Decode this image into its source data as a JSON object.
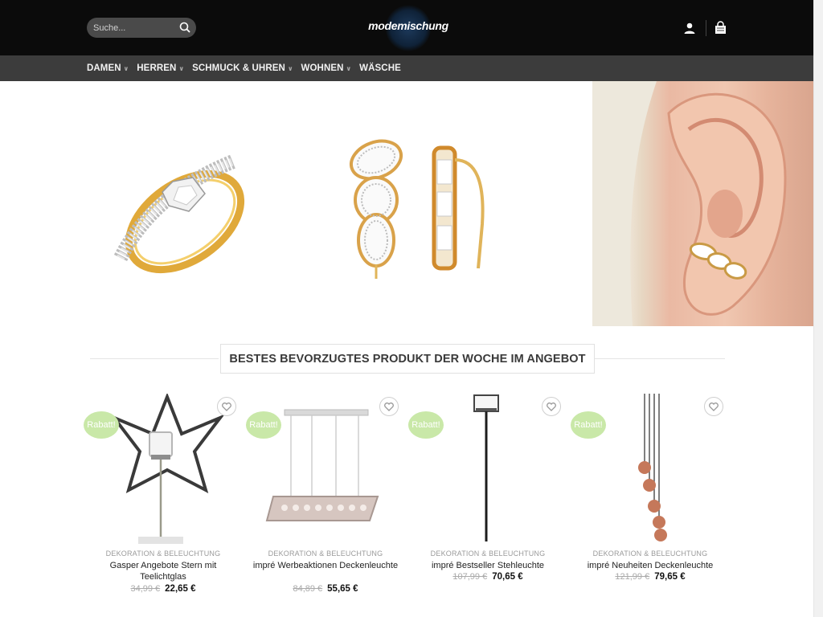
{
  "header": {
    "search_placeholder": "Suche...",
    "logo_text": "modemischung"
  },
  "nav": [
    {
      "label": "DAMEN",
      "has_dropdown": true
    },
    {
      "label": "HERREN",
      "has_dropdown": true
    },
    {
      "label": "SCHMUCK & UHREN",
      "has_dropdown": true
    },
    {
      "label": "WOHNEN",
      "has_dropdown": true
    },
    {
      "label": "WÄSCHE",
      "has_dropdown": false
    }
  ],
  "section_title": "BESTES BEVORZUGTES PRODUKT DER WOCHE IM ANGEBOT",
  "badge_label": "Rabatt!",
  "products": [
    {
      "category": "DEKORATION & BELEUCHTUNG",
      "name": "Gasper Angebote Stern mit Teelichtglas",
      "old_price": "34,99 €",
      "price": "22,65 €"
    },
    {
      "category": "DEKORATION & BELEUCHTUNG",
      "name": "impré Werbeaktionen Deckenleuchte",
      "old_price": "84,89 €",
      "price": "55,65 €"
    },
    {
      "category": "DEKORATION & BELEUCHTUNG",
      "name": "impré Bestseller Stehleuchte",
      "old_price": "107,99 €",
      "price": "70,65 €"
    },
    {
      "category": "DEKORATION & BELEUCHTUNG",
      "name": "impré Neuheiten Deckenleuchte",
      "old_price": "121,99 €",
      "price": "79,65 €"
    }
  ],
  "colors": {
    "header_bg": "#0b0b0b",
    "nav_bg": "#3c3c3c",
    "badge": "#c9e8a8"
  }
}
